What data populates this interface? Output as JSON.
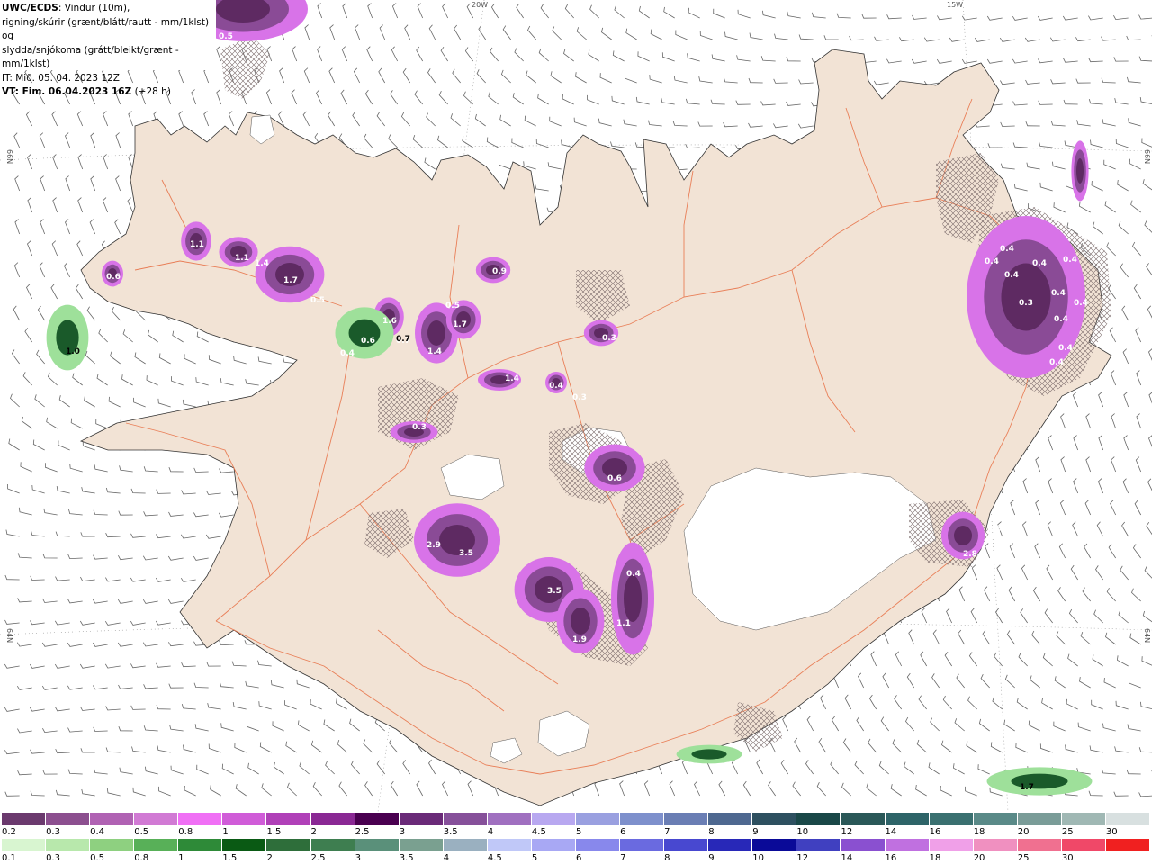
{
  "header": {
    "line1_bold": "UWC/ECDS",
    "line1_rest": ": Vindur (10m),",
    "line2": "rigning/skúrir (grænt/blátt/rautt - mm/1klst) og",
    "line3": "slydda/snjókoma (grátt/bleikt/grænt - mm/1klst)",
    "line4": "IT: Mið. 05. 04. 2023 12Z",
    "line5_bold": "VT: Fim. 06.04.2023 16Z",
    "line5_rest": " (+28 h)"
  },
  "grid_labels": {
    "lon_20w": "20W",
    "lon_15w": "15W",
    "lat_66n_left": "66N",
    "lat_66n_right": "66N",
    "lat_64n_left": "64N",
    "lat_64n_right": "64N"
  },
  "colors": {
    "land": "#f2e3d5",
    "sea": "#ffffff",
    "roads": "#e8744a",
    "snow_dark": "#5e2a62",
    "snow_mid": "#8a4b96",
    "snow_light": "#d873e8",
    "rain_dark": "#1a5a2a",
    "rain_light": "#9ee09a"
  },
  "precip_labels": [
    {
      "text": "0.5"
    },
    {
      "text": "1.1"
    },
    {
      "text": "1.1"
    },
    {
      "text": "1.4"
    },
    {
      "text": "1.7"
    },
    {
      "text": "0.6"
    },
    {
      "text": "0.5"
    },
    {
      "text": "0.6"
    },
    {
      "text": "1.6"
    },
    {
      "text": "0.7"
    },
    {
      "text": "0.4"
    },
    {
      "text": "0.5"
    },
    {
      "text": "1.4"
    },
    {
      "text": "1.7"
    },
    {
      "text": "0.3"
    },
    {
      "text": "0.9"
    },
    {
      "text": "0.3"
    },
    {
      "text": "1.4"
    },
    {
      "text": "0.4"
    },
    {
      "text": "0.3"
    },
    {
      "text": "0.6"
    },
    {
      "text": "2.9"
    },
    {
      "text": "3.5"
    },
    {
      "text": "3.5"
    },
    {
      "text": "0.4"
    },
    {
      "text": "1.9"
    },
    {
      "text": "1.1"
    },
    {
      "text": "0.4"
    },
    {
      "text": "0.4"
    },
    {
      "text": "0.4"
    },
    {
      "text": "0.4"
    },
    {
      "text": "0.4"
    },
    {
      "text": "0.3"
    },
    {
      "text": "0.4"
    },
    {
      "text": "0.4"
    },
    {
      "text": "0.4"
    },
    {
      "text": "0.4"
    },
    {
      "text": "0.4"
    },
    {
      "text": "2.8"
    },
    {
      "text": "0.5"
    },
    {
      "text": "1.0"
    },
    {
      "text": "0.7"
    },
    {
      "text": "1.7"
    }
  ],
  "legend": {
    "snow_colors": [
      "#6b3a6e",
      "#8c4f8f",
      "#b062b3",
      "#d17ad4",
      "#f070f5",
      "#d05cd8",
      "#b040b8",
      "#8a2894",
      "#4a0050",
      "#6a2a78",
      "#86509a",
      "#a070c0",
      "#b8a8f0",
      "#9aa0e0",
      "#7e90cc",
      "#6a7eb4",
      "#4e6890",
      "#2e5060",
      "#1a4848",
      "#2a5858",
      "#2e6468",
      "#3a7070",
      "#5a8a88",
      "#7a9c98",
      "#a0b8b4",
      "#d8e0e0"
    ],
    "snow_labels": [
      "0.2",
      "0.3",
      "0.4",
      "0.5",
      "0.8",
      "1",
      "1.5",
      "2",
      "2.5",
      "3",
      "3.5",
      "4",
      "4.5",
      "5",
      "6",
      "7",
      "8",
      "9",
      "10",
      "12",
      "14",
      "16",
      "18",
      "20",
      "25",
      "30"
    ],
    "rain_colors": [
      "#d8f5d0",
      "#b8e8ac",
      "#8ed080",
      "#58b058",
      "#2e8a38",
      "#0a5a14",
      "#2e6e3a",
      "#3e7e50",
      "#5a907a",
      "#7aa090",
      "#9ab0c0",
      "#c0c8f8",
      "#a8a8f4",
      "#8888ec",
      "#6a6ae0",
      "#4848d0",
      "#2828b8",
      "#0a0a98",
      "#4040c0",
      "#8a50d0",
      "#c070e0",
      "#f0a0e8",
      "#f090c0",
      "#f07090",
      "#f04868",
      "#f02020"
    ],
    "rain_labels": [
      "0.1",
      "0.3",
      "0.5",
      "0.8",
      "1",
      "1.5",
      "2",
      "2.5",
      "3",
      "3.5",
      "4",
      "4.5",
      "5",
      "6",
      "7",
      "8",
      "9",
      "10",
      "12",
      "14",
      "16",
      "18",
      "20",
      "25",
      "30"
    ]
  }
}
